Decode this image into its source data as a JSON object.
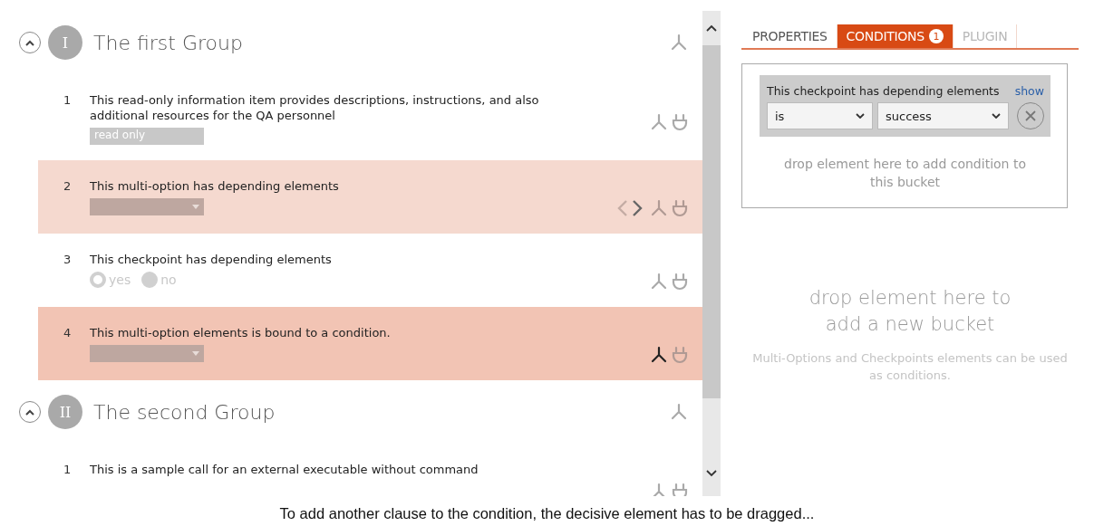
{
  "groups": [
    {
      "numeral": "I",
      "title": "The first Group",
      "expanded": true,
      "items": [
        {
          "number": "1",
          "kind": "info",
          "text": "This read-only information item provides descriptions, instructions, and also additional resources for the QA personnel",
          "field_value": "read only",
          "color": "#ffffff",
          "nav_arrows": false,
          "condition_bound": false
        },
        {
          "number": "2",
          "kind": "multi",
          "text": "This multi-option has depending elements",
          "color": "#f5d9cf",
          "nav_arrows": true,
          "condition_bound": false
        },
        {
          "number": "3",
          "kind": "checkpoint",
          "text": "This checkpoint has depending elements",
          "options": [
            {
              "label": "yes",
              "selected": false
            },
            {
              "label": "no",
              "selected": true
            }
          ],
          "color": "#ffffff",
          "nav_arrows": false,
          "condition_bound": false
        },
        {
          "number": "4",
          "kind": "multi",
          "text": "This multi-option elements is bound to a condition.",
          "color": "#f2c4b4",
          "nav_arrows": false,
          "condition_bound": true
        }
      ]
    },
    {
      "numeral": "II",
      "title": "The second Group",
      "expanded": true,
      "items": [
        {
          "number": "1",
          "kind": "call",
          "text": "This is a sample call for an external executable without command",
          "color": "#ffffff",
          "nav_arrows": false,
          "condition_bound": false
        }
      ]
    }
  ],
  "tabs": [
    {
      "label": "PROPERTIES",
      "selected": false,
      "disabled": false
    },
    {
      "label": "CONDITIONS",
      "badge": "1",
      "selected": true,
      "disabled": false
    },
    {
      "label": "PLUGIN",
      "selected": false,
      "disabled": true
    }
  ],
  "bucket": {
    "condition": {
      "element": "This checkpoint has depending elements",
      "link": "show",
      "operator": "is",
      "value": "success"
    },
    "drop_hint": "drop element here to add condition to this bucket"
  },
  "new_bucket": {
    "title": "drop element here to add a new bucket",
    "hint": "Multi-Options and Checkpoints elements can be used as conditions."
  },
  "caption": "To add another clause to the condition, the decisive element has to be dragged..."
}
